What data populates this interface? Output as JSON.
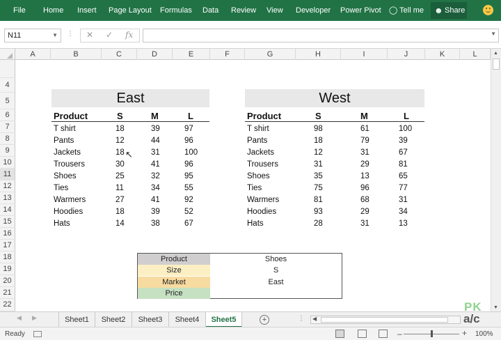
{
  "ribbon": {
    "tabs": [
      "File",
      "Home",
      "Insert",
      "Page Layout",
      "Formulas",
      "Data",
      "Review",
      "View",
      "Developer",
      "Power Pivot"
    ],
    "tell_me": "Tell me",
    "share": "Share",
    "color": "#217346"
  },
  "formula_bar": {
    "name_box": "N11",
    "fx": "fx",
    "formula": ""
  },
  "columns": [
    "A",
    "B",
    "C",
    "D",
    "E",
    "F",
    "G",
    "H",
    "I",
    "J",
    "K",
    "L"
  ],
  "rows": [
    "4",
    "5",
    "6",
    "7",
    "8",
    "9",
    "10",
    "11",
    "12",
    "13",
    "14",
    "15",
    "16",
    "17",
    "18",
    "19",
    "20",
    "21",
    "22"
  ],
  "east": {
    "region": "East",
    "headers": [
      "Product",
      "S",
      "M",
      "L"
    ],
    "rows": [
      [
        "T shirt",
        "18",
        "39",
        "97"
      ],
      [
        "Pants",
        "12",
        "44",
        "96"
      ],
      [
        "Jackets",
        "18",
        "31",
        "100"
      ],
      [
        "Trousers",
        "30",
        "41",
        "96"
      ],
      [
        "Shoes",
        "25",
        "32",
        "95"
      ],
      [
        "Ties",
        "11",
        "34",
        "55"
      ],
      [
        "Warmers",
        "27",
        "41",
        "92"
      ],
      [
        "Hoodies",
        "18",
        "39",
        "52"
      ],
      [
        "Hats",
        "14",
        "38",
        "67"
      ]
    ]
  },
  "west": {
    "region": "West",
    "headers": [
      "Product",
      "S",
      "M",
      "L"
    ],
    "rows": [
      [
        "T shirt",
        "98",
        "61",
        "100"
      ],
      [
        "Pants",
        "18",
        "79",
        "39"
      ],
      [
        "Jackets",
        "12",
        "31",
        "67"
      ],
      [
        "Trousers",
        "31",
        "29",
        "81"
      ],
      [
        "Shoes",
        "35",
        "13",
        "65"
      ],
      [
        "Ties",
        "75",
        "96",
        "77"
      ],
      [
        "Warmers",
        "81",
        "68",
        "31"
      ],
      [
        "Hoodies",
        "93",
        "29",
        "34"
      ],
      [
        "Hats",
        "28",
        "31",
        "13"
      ]
    ]
  },
  "lookup": [
    {
      "label": "Product",
      "value": "Shoes",
      "color": "#d0cece"
    },
    {
      "label": "Size",
      "value": "S",
      "color": "#fcefc3"
    },
    {
      "label": "Market",
      "value": "East",
      "color": "#f8dba0"
    },
    {
      "label": "Price",
      "value": "",
      "color": "#c6e0c2"
    }
  ],
  "sheets": [
    "Sheet1",
    "Sheet2",
    "Sheet3",
    "Sheet4",
    "Sheet5"
  ],
  "active_sheet": "Sheet5",
  "watermark": {
    "line1": "PK",
    "line2": "a/c"
  },
  "status": {
    "ready": "Ready",
    "zoom": "100%"
  }
}
